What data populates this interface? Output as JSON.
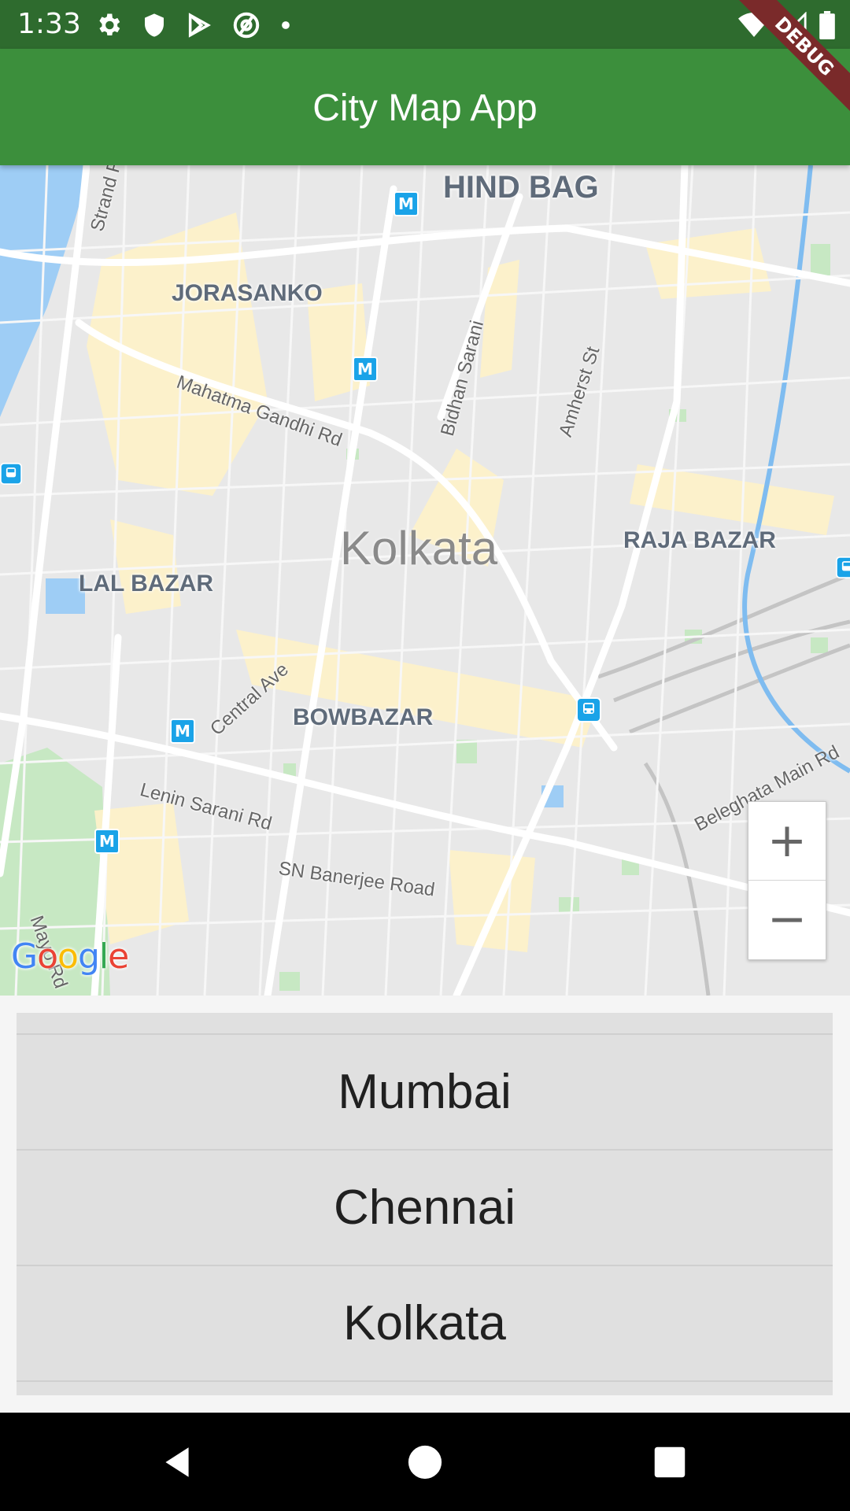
{
  "status_bar": {
    "time": "1:33",
    "left_icons": [
      "settings-icon",
      "shield-icon",
      "play-store-icon",
      "at-sign-icon",
      "dot-icon"
    ],
    "right_icons": [
      "wifi-icon",
      "signal-icon",
      "battery-icon"
    ]
  },
  "debug_banner": "DEBUG",
  "app_bar": {
    "title": "City Map App",
    "color": "#3c8f3c"
  },
  "map": {
    "city_label": "Kolkata",
    "area_labels": {
      "hind_bag": "HIND BAG",
      "jorasanko": "JORASANKO",
      "raja_bazar": "RAJA BAZAR",
      "lal_bazar": "LAL BAZAR",
      "bowbazar": "BOWBAZAR"
    },
    "road_labels": {
      "strand_rd": "Strand Rd",
      "mahatma_gandhi_rd": "Mahatma Gandhi Rd",
      "bidhan_sarani": "Bidhan Sarani",
      "amherst_st": "Amherst St",
      "central_ave": "Central Ave",
      "lenin_sarani_rd": "Lenin Sarani Rd",
      "sn_banerjee_road": "SN Banerjee Road",
      "beleghata_main_rd": "Beleghata Main Rd",
      "mayo_rd": "Mayo Rd"
    },
    "metro_marker": "M",
    "zoom_in": "+",
    "zoom_out": "−",
    "attribution": "Google"
  },
  "cities": [
    "Mumbai",
    "Chennai",
    "Kolkata"
  ],
  "nav_bar": {
    "buttons": [
      "back-icon",
      "home-icon",
      "recents-icon"
    ]
  }
}
